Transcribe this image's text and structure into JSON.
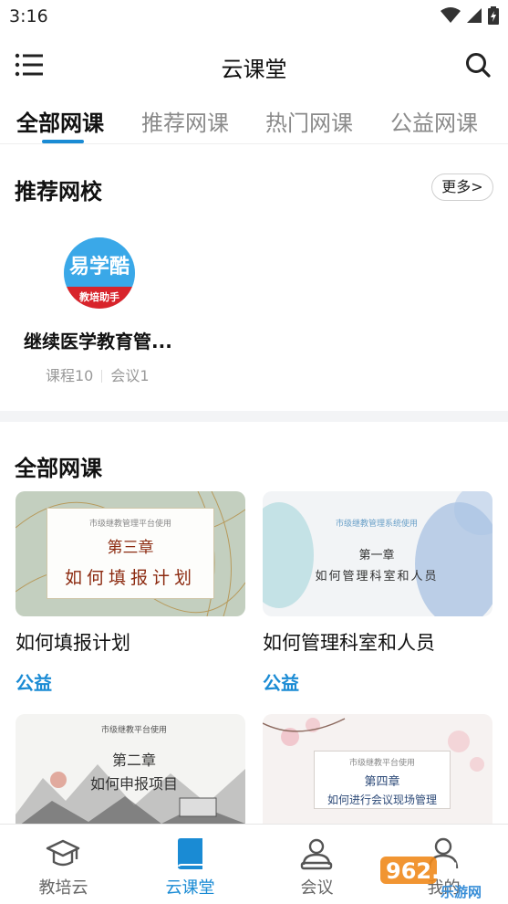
{
  "status_bar": {
    "time": "3:16"
  },
  "header": {
    "title": "云课堂"
  },
  "tabs": [
    {
      "label": "全部网课",
      "active": true
    },
    {
      "label": "推荐网课",
      "active": false
    },
    {
      "label": "热门网课",
      "active": false
    },
    {
      "label": "公益网课",
      "active": false
    }
  ],
  "recommended_schools": {
    "title": "推荐网校",
    "more_label": "更多>",
    "items": [
      {
        "logo_text": "易学酷",
        "logo_sub": "教培助手",
        "name": "继续医学教育管...",
        "courses": "课程10",
        "meetings": "会议1"
      }
    ]
  },
  "all_courses": {
    "title": "全部网课",
    "items": [
      {
        "title": "如何填报计划",
        "tag": "公益",
        "thumb_small": "市级继教管理平台使用",
        "thumb_chapter": "第三章",
        "thumb_heading": "如何填报计划"
      },
      {
        "title": "如何管理科室和人员",
        "tag": "公益",
        "thumb_small": "市级继教管理系统使用",
        "thumb_chapter": "第一章",
        "thumb_heading": "如何管理科室和人员"
      },
      {
        "title": "",
        "tag": "",
        "thumb_small": "市级继教平台使用",
        "thumb_chapter": "第二章",
        "thumb_heading": "如何申报项目"
      },
      {
        "title": "",
        "tag": "",
        "thumb_small": "市级继教平台使用",
        "thumb_chapter": "第四章",
        "thumb_heading": "如何进行会议现场管理"
      }
    ]
  },
  "bottom_nav": [
    {
      "label": "教培云",
      "icon": "graduation-cap-icon",
      "active": false
    },
    {
      "label": "云课堂",
      "icon": "book-icon",
      "active": true
    },
    {
      "label": "会议",
      "icon": "meeting-icon",
      "active": false
    },
    {
      "label": "我的",
      "icon": "person-icon",
      "active": false
    }
  ],
  "watermark": {
    "text": "962.NET",
    "sub": "乐游网"
  },
  "colors": {
    "accent": "#1a8bd4",
    "background": "#ffffff",
    "section_gap": "#f3f4f6"
  }
}
